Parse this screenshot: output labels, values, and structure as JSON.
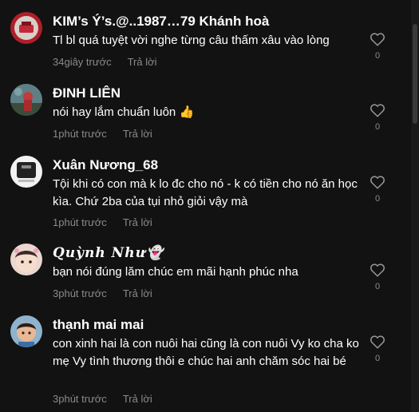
{
  "comments": [
    {
      "username": "KIM’s Ý’s.@..1987…79 Khánh hoà",
      "text": "Tl bl quá tuyệt vời nghe từng câu thấm xâu vào lòng",
      "time": "34giây trước",
      "reply_label": "Trả lời",
      "likes": "0"
    },
    {
      "username": "ĐINH LIÊN",
      "text": "nói hay lắm chuẩn luôn 👍",
      "time": "1phút trước",
      "reply_label": "Trả lời",
      "likes": "0"
    },
    {
      "username": "Xuân Nương_68",
      "text": "Tội khi có con mà k lo đc cho nó - k có tiền cho nó ăn học kìa. Chứ 2ba của tụi nhỏ giỏi vậy mà",
      "time": "1phút trước",
      "reply_label": "Trả lời",
      "likes": "0"
    },
    {
      "username": "𝑸𝒖𝒚̀𝒏𝒉 𝑵𝒉𝒖̛👻",
      "text": "bạn nói đúng lăm chúc em mãi hạnh phúc nha",
      "time": "3phút trước",
      "reply_label": "Trả lời",
      "likes": "0"
    },
    {
      "username": "thạnh mai mai",
      "text": "con xinh hai là con nuôi hai cũng là con nuôi Vy ko cha ko mẹ Vy tình thương thôi e chúc hai anh chăm sóc hai bé",
      "time": "3phút trước",
      "reply_label": "Trả lời",
      "likes": "0"
    }
  ],
  "icons": {
    "like": "heart-outline-icon"
  },
  "colors": {
    "background": "#121212",
    "text_primary": "#ffffff",
    "text_secondary": "#8a8a8a"
  }
}
